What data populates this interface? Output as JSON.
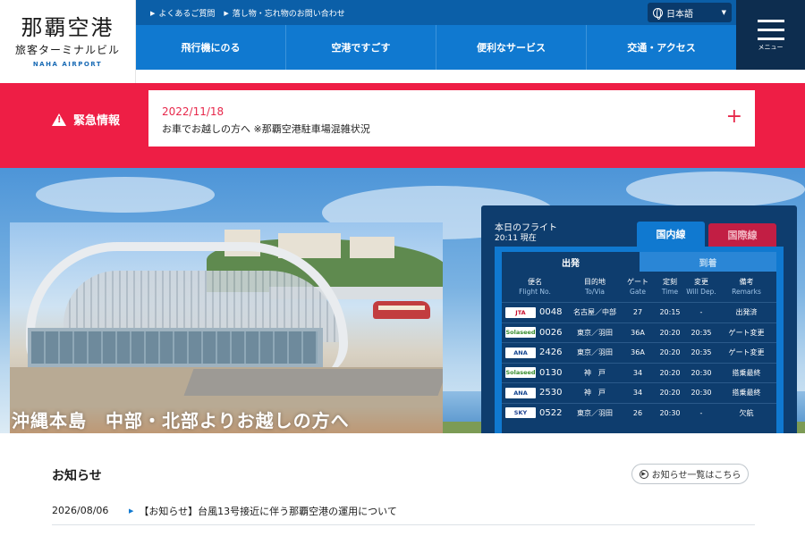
{
  "logo": {
    "main": "那覇空港",
    "sub": "旅客ターミナルビル",
    "en": "NAHA AIRPORT"
  },
  "toplinks": [
    "よくあるご質問",
    "落し物・忘れ物のお問い合わせ"
  ],
  "language": "日本語",
  "nav": [
    "飛行機にのる",
    "空港ですごす",
    "便利なサービス",
    "交通・アクセス"
  ],
  "menu_label": "メニュー",
  "emergency": {
    "label": "緊急情報",
    "date": "2022/11/18",
    "text": "お車でお越しの方へ ※那覇空港駐車場混雑状況"
  },
  "hero": {
    "caption": "沖縄本島　中部・北部よりお越しの方へ"
  },
  "flights": {
    "title": "本日のフライト",
    "time": "20:11 現在",
    "tab_domestic": "国内線",
    "tab_international": "国際線",
    "tab_departure": "出発",
    "tab_arrival": "到着",
    "headers": [
      {
        "jp": "便名",
        "en": "Flight No."
      },
      {
        "jp": "目的地",
        "en": "To/Via"
      },
      {
        "jp": "ゲート",
        "en": "Gate"
      },
      {
        "jp": "定刻",
        "en": "Time"
      },
      {
        "jp": "変更",
        "en": "Will Dep."
      },
      {
        "jp": "備考",
        "en": "Remarks"
      }
    ],
    "rows": [
      {
        "airline": "JTA",
        "no": "0048",
        "to": "名古屋／中部",
        "gate": "27",
        "time": "20:15",
        "change": "-",
        "remarks": "出発済"
      },
      {
        "airline": "Solaseed Air",
        "no": "0026",
        "to": "東京／羽田",
        "gate": "36A",
        "time": "20:20",
        "change": "20:35",
        "remarks": "ゲート変更"
      },
      {
        "airline": "ANA",
        "no": "2426",
        "to": "東京／羽田",
        "gate": "36A",
        "time": "20:20",
        "change": "20:35",
        "remarks": "ゲート変更"
      },
      {
        "airline": "Solaseed Air",
        "no": "0130",
        "to": "神　戸",
        "gate": "34",
        "time": "20:20",
        "change": "20:30",
        "remarks": "搭乗最終"
      },
      {
        "airline": "ANA",
        "no": "2530",
        "to": "神　戸",
        "gate": "34",
        "time": "20:20",
        "change": "20:30",
        "remarks": "搭乗最終"
      },
      {
        "airline": "SKY",
        "no": "0522",
        "to": "東京／羽田",
        "gate": "26",
        "time": "20:30",
        "change": "-",
        "remarks": "欠航"
      }
    ]
  },
  "news": {
    "title": "お知らせ",
    "button": "お知らせ一覧はこちら",
    "items": [
      {
        "date": "2026/08/06",
        "text": "【お知らせ】台風13号接近に伴う那覇空港の運用について"
      }
    ]
  },
  "colors": {
    "brand_blue": "#1079d0",
    "dark_blue": "#0e3d6e",
    "emergency_red": "#ee1e45",
    "intl_red": "#c21e44"
  }
}
